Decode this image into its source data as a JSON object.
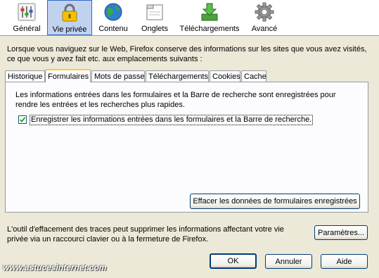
{
  "toolbar": {
    "items": [
      {
        "label": "Général",
        "icon": "sliders-icon"
      },
      {
        "label": "Vie privée",
        "icon": "padlock-icon",
        "selected": true
      },
      {
        "label": "Contenu",
        "icon": "globe-icon"
      },
      {
        "label": "Onglets",
        "icon": "tabs-window-icon"
      },
      {
        "label": "Téléchargements",
        "icon": "download-arrow-icon"
      },
      {
        "label": "Avancé",
        "icon": "gear-icon"
      }
    ]
  },
  "intro": "Lorsque vous naviguez sur le Web, Firefox conserve des informations sur les sites que vous avez visités, ce que vous y avez fait etc. aux emplacements suivants :",
  "tabs": [
    "Historique",
    "Formulaires",
    "Mots de passe",
    "Téléchargements",
    "Cookies",
    "Cache"
  ],
  "active_tab": "Formulaires",
  "panel": {
    "description": "Les informations entrées dans les formulaires et la Barre de recherche sont enregistrées pour rendre les entrées et les recherches plus rapides.",
    "checkbox_label": "Enregistrer les informations entrées dans les formulaires et la Barre de recherche.",
    "checkbox_checked": true,
    "clear_button": "Effacer les données de formulaires enregistrées"
  },
  "footer": {
    "text": "L'outil d'effacement des traces peut supprimer les informations affectant votre vie privée via un raccourci clavier ou à la fermeture de Firefox.",
    "settings_button": "Paramètres..."
  },
  "buttons": {
    "ok": "OK",
    "cancel": "Annuler",
    "help": "Aide"
  },
  "watermark": "www.astucesinternet.com",
  "colors": {
    "selected_bg": "#c1d2ee",
    "window_bg": "#ece9d8",
    "tab_highlight": "#ffc83c"
  }
}
